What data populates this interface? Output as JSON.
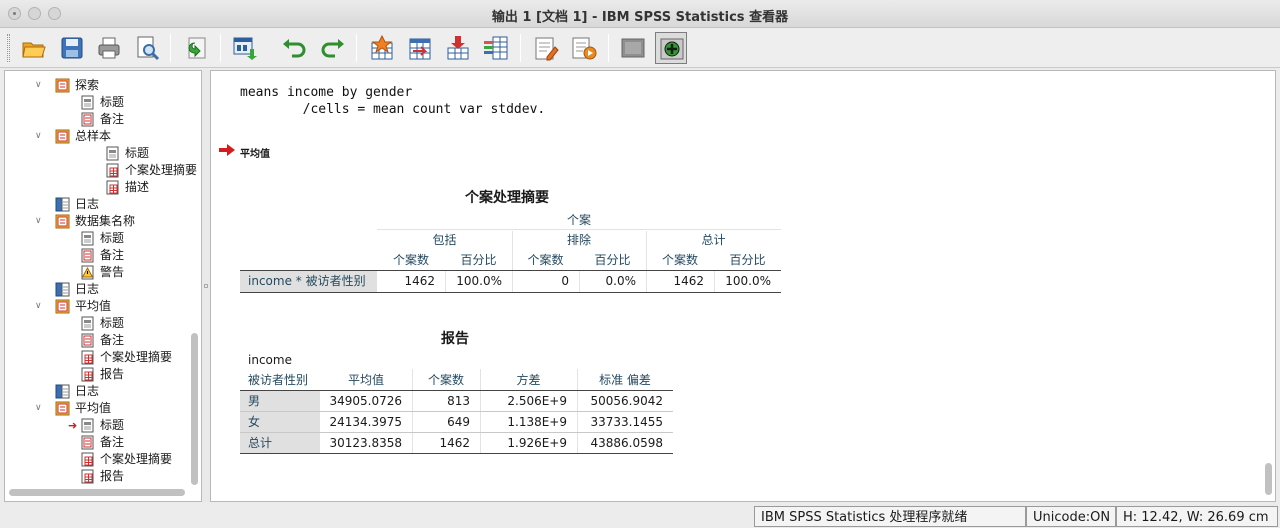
{
  "window": {
    "title": "输出 1 [文档 1] - IBM SPSS Statistics 查看器"
  },
  "toolbar": {
    "buttons": [
      "open-icon",
      "save-icon",
      "print-icon",
      "print-preview-icon",
      "export-icon",
      "recall-dialog-icon",
      "undo-icon",
      "redo-icon",
      "goto-data-icon",
      "goto-case-icon",
      "goto-variable-icon",
      "variables-icon",
      "designate-window-icon",
      "run-script-icon",
      "hide-icon",
      "insert-output-icon"
    ]
  },
  "outline": {
    "items": [
      {
        "label": "探索",
        "icon": "book-icon",
        "expanded": true
      },
      {
        "label": "标题",
        "icon": "title-icon"
      },
      {
        "label": "备注",
        "icon": "notes-icon"
      },
      {
        "label": "总样本",
        "icon": "book-icon",
        "expanded": true
      },
      {
        "label": "标题",
        "icon": "title-icon"
      },
      {
        "label": "个案处理摘要",
        "icon": "table-icon"
      },
      {
        "label": "描述",
        "icon": "table-icon"
      },
      {
        "label": "日志",
        "icon": "log-icon"
      },
      {
        "label": "数据集名称",
        "icon": "book-icon",
        "expanded": true
      },
      {
        "label": "标题",
        "icon": "title-icon"
      },
      {
        "label": "备注",
        "icon": "notes-icon"
      },
      {
        "label": "警告",
        "icon": "warning-icon"
      },
      {
        "label": "日志",
        "icon": "log-icon"
      },
      {
        "label": "平均值",
        "icon": "book-icon",
        "expanded": true
      },
      {
        "label": "标题",
        "icon": "title-icon"
      },
      {
        "label": "备注",
        "icon": "notes-icon"
      },
      {
        "label": "个案处理摘要",
        "icon": "table-icon"
      },
      {
        "label": "报告",
        "icon": "table-icon"
      },
      {
        "label": "日志",
        "icon": "log-icon"
      },
      {
        "label": "平均值",
        "icon": "book-icon",
        "expanded": true
      },
      {
        "label": "标题",
        "icon": "title-icon",
        "current": true
      },
      {
        "label": "备注",
        "icon": "notes-icon"
      },
      {
        "label": "个案处理摘要",
        "icon": "table-icon"
      },
      {
        "label": "报告",
        "icon": "table-icon"
      }
    ]
  },
  "content": {
    "syntax_line1": "means income by gender",
    "syntax_line2": "        /cells = mean count var stddev.",
    "section_heading": "平均值",
    "summary": {
      "title": "个案处理摘要",
      "col_header_top": "个案",
      "groups": [
        "包括",
        "排除",
        "总计"
      ],
      "subheaders": [
        "个案数",
        "百分比",
        "个案数",
        "百分比",
        "个案数",
        "百分比"
      ],
      "row_label": "income  * 被访者性别",
      "values": [
        "1462",
        "100.0%",
        "0",
        "0.0%",
        "1462",
        "100.0%"
      ]
    },
    "report": {
      "title": "报告",
      "layer": "income",
      "headers": [
        "被访者性别",
        "平均值",
        "个案数",
        "方差",
        "标准 偏差"
      ],
      "rows": [
        [
          "男",
          "34905.0726",
          "813",
          "2.506E+9",
          "50056.9042"
        ],
        [
          "女",
          "24134.3975",
          "649",
          "1.138E+9",
          "33733.1455"
        ],
        [
          "总计",
          "30123.8358",
          "1462",
          "1.926E+9",
          "43886.0598"
        ]
      ]
    }
  },
  "statusbar": {
    "processor": "IBM SPSS Statistics 处理程序就绪",
    "unicode": "Unicode:ON",
    "dims": "H: 12.42, W: 26.69 cm"
  }
}
